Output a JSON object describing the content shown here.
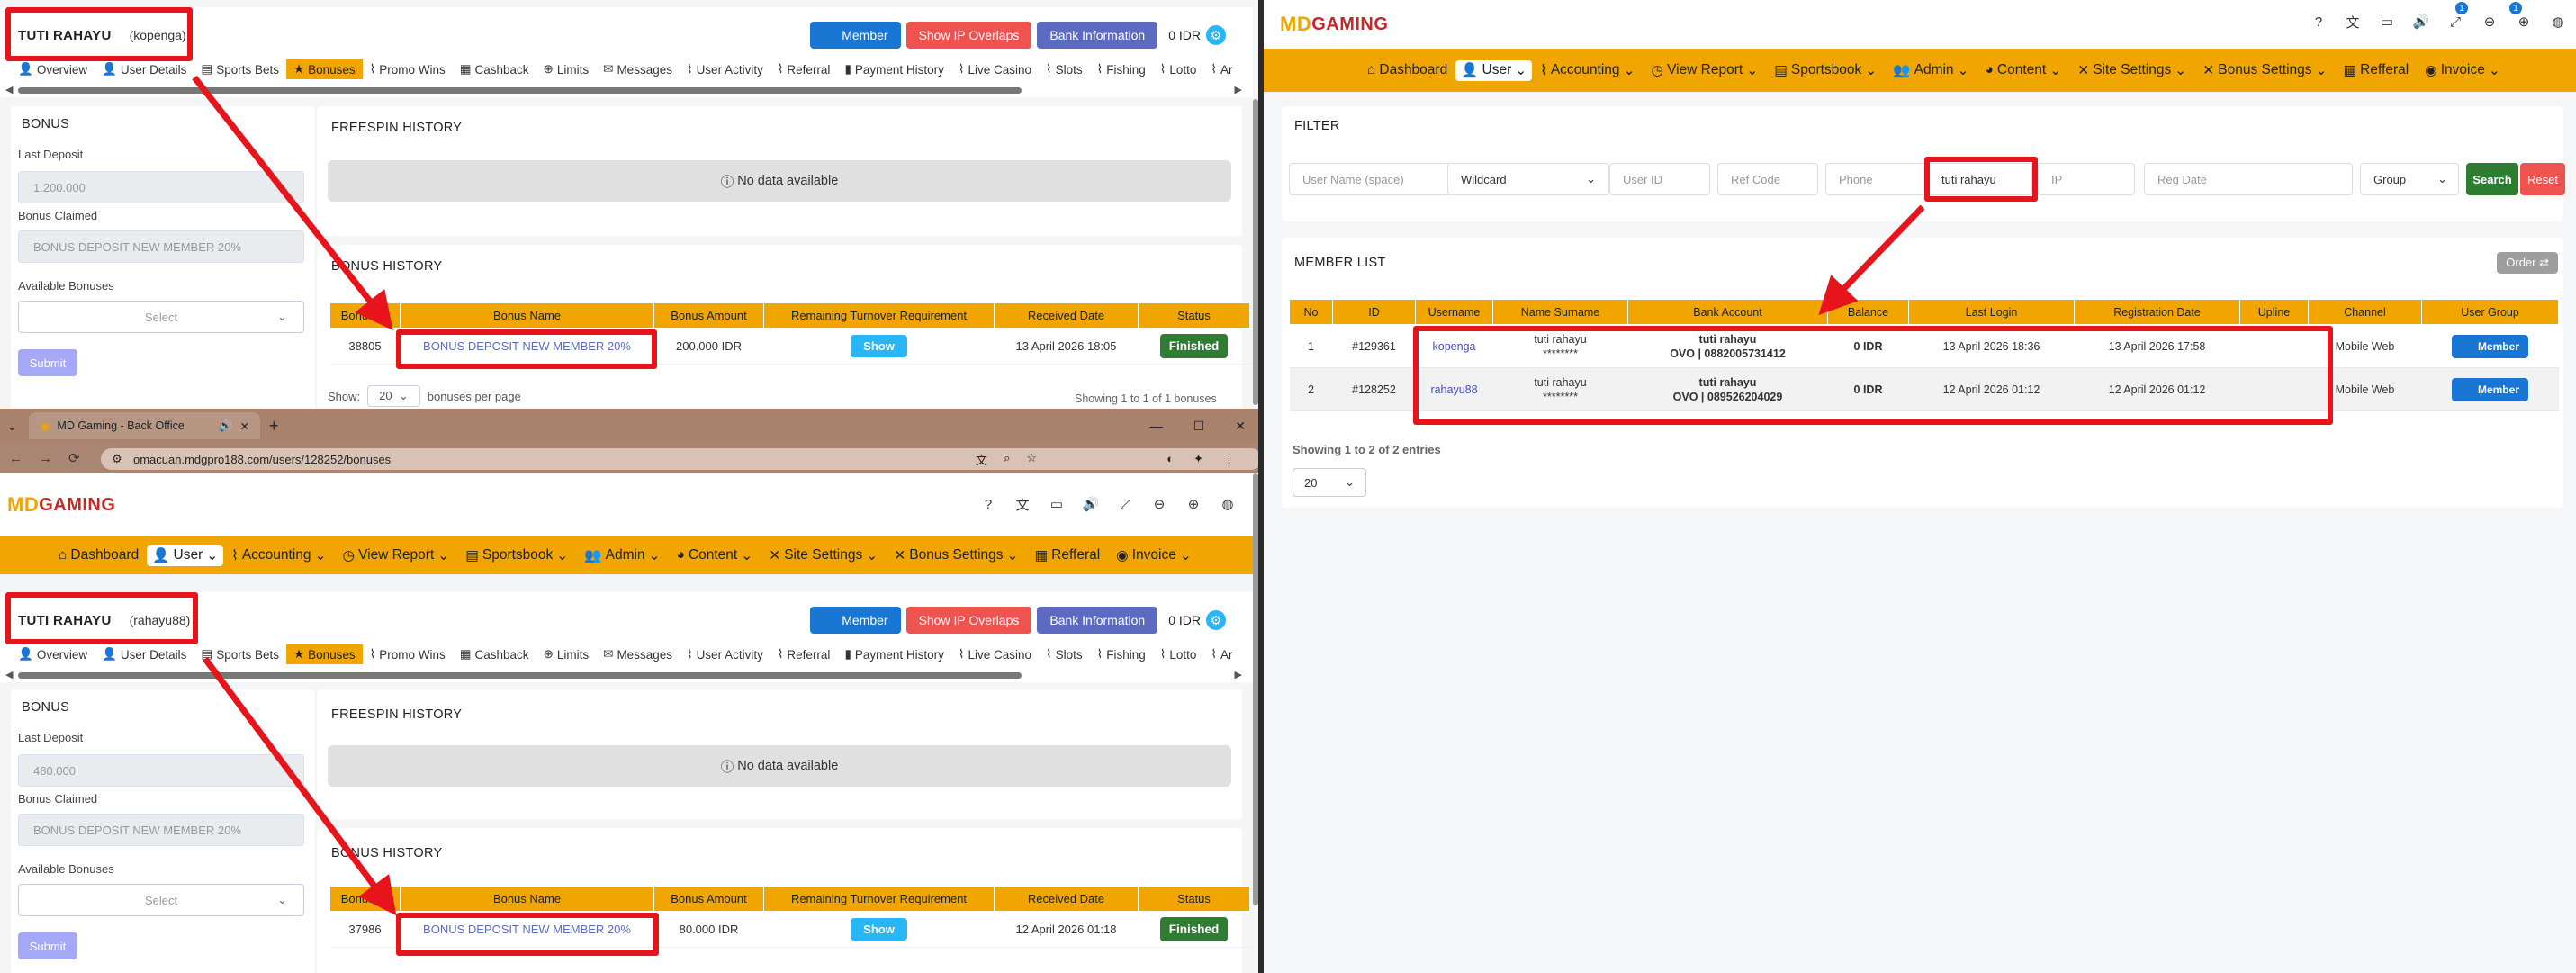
{
  "user_top": {
    "name": "TUTI RAHAYU",
    "username": "(kopenga)",
    "member_label": "Member",
    "ip_overlaps_label": "Show IP Overlaps",
    "bank_info_label": "Bank Information",
    "balance": "0 IDR",
    "last_deposit": "1.200.000",
    "bonus_claimed": "BONUS DEPOSIT NEW MEMBER 20%",
    "bonus_row": {
      "id": "38805",
      "name": "BONUS DEPOSIT NEW MEMBER 20%",
      "amount": "200.000 IDR",
      "show": "Show",
      "date": "13 April 2026 18:05",
      "status": "Finished"
    },
    "per_page": "20",
    "showing": "Showing 1 to 1 of 1 bonuses"
  },
  "user_bottom": {
    "name": "TUTI RAHAYU",
    "username": "(rahayu88)",
    "member_label": "Member",
    "ip_overlaps_label": "Show IP Overlaps",
    "bank_info_label": "Bank Information",
    "balance": "0 IDR",
    "last_deposit": "480.000",
    "bonus_claimed": "BONUS DEPOSIT NEW MEMBER 20%",
    "bonus_row": {
      "id": "37986",
      "name": "BONUS DEPOSIT NEW MEMBER 20%",
      "amount": "80.000 IDR",
      "show": "Show",
      "date": "12 April 2026 01:18",
      "status": "Finished"
    }
  },
  "tabs": [
    "Overview",
    "User Details",
    "Sports Bets",
    "Bonuses",
    "Promo Wins",
    "Cashback",
    "Limits",
    "Messages",
    "User Activity",
    "Referral",
    "Payment History",
    "Live Casino",
    "Slots",
    "Fishing",
    "Lotto",
    "Ar"
  ],
  "bonus_panel": {
    "title": "BONUS",
    "last_deposit_label": "Last Deposit",
    "bonus_claimed_label": "Bonus Claimed",
    "available_label": "Available Bonuses",
    "select_placeholder": "Select",
    "submit_label": "Submit"
  },
  "freespin": {
    "title": "FREESPIN HISTORY",
    "no_data": "No data available"
  },
  "bonus_history": {
    "title": "BONUS HISTORY",
    "columns": [
      "Bonus ID",
      "Bonus Name",
      "Bonus Amount",
      "Remaining Turnover Requirement",
      "Received Date",
      "Status"
    ],
    "show_label": "Show:",
    "per_page_label": "bonuses per page"
  },
  "browser": {
    "tab_title": "MD Gaming - Back Office",
    "url": "omacuan.mdgpro188.com/users/128252/bonuses"
  },
  "logo": {
    "md": "MD",
    "rest": "GAMING"
  },
  "nav": [
    "Dashboard",
    "User",
    "Accounting",
    "View Report",
    "Sportsbook",
    "Admin",
    "Content",
    "Site Settings",
    "Bonus Settings",
    "Refferal",
    "Invoice"
  ],
  "filter": {
    "title": "FILTER",
    "username_placeholder": "User Name (space)",
    "wildcard": "Wildcard",
    "userid_placeholder": "User ID",
    "refcode_placeholder": "Ref Code",
    "phone_placeholder": "Phone",
    "name_value": "tuti rahayu",
    "ip_placeholder": "IP",
    "regdate_placeholder": "Reg Date",
    "group": "Group",
    "search_label": "Search",
    "reset_label": "Reset"
  },
  "member_list": {
    "title": "MEMBER LIST",
    "order_label": "Order",
    "columns": [
      "No",
      "ID",
      "Username",
      "Name Surname",
      "Bank Account",
      "Balance",
      "Last Login",
      "Registration Date",
      "Upline",
      "Channel",
      "User Group"
    ],
    "rows": [
      {
        "no": "1",
        "id": "#129361",
        "username": "kopenga",
        "name": "tuti rahayu",
        "mask": "********",
        "bank_name": "tuti rahayu",
        "bank_acc": "OVO | 0882005731412",
        "balance": "0 IDR",
        "last_login": "13 April 2026 18:36",
        "reg_date": "13 April 2026 17:58",
        "upline": "",
        "channel": "Mobile Web",
        "group": "Member"
      },
      {
        "no": "2",
        "id": "#128252",
        "username": "rahayu88",
        "name": "tuti rahayu",
        "mask": "********",
        "bank_name": "tuti rahayu",
        "bank_acc": "OVO | 089526204029",
        "balance": "0 IDR",
        "last_login": "12 April 2026 01:12",
        "reg_date": "12 April 2026 01:12",
        "upline": "",
        "channel": "Mobile Web",
        "group": "Member"
      }
    ],
    "showing": "Showing 1 to 2 of 2 entries",
    "per_page": "20"
  },
  "notif_count": "1",
  "colors": {
    "accent": "#f0a500",
    "highlight": "#e8141c",
    "member": "#1976d2",
    "success": "#2e7d32"
  }
}
